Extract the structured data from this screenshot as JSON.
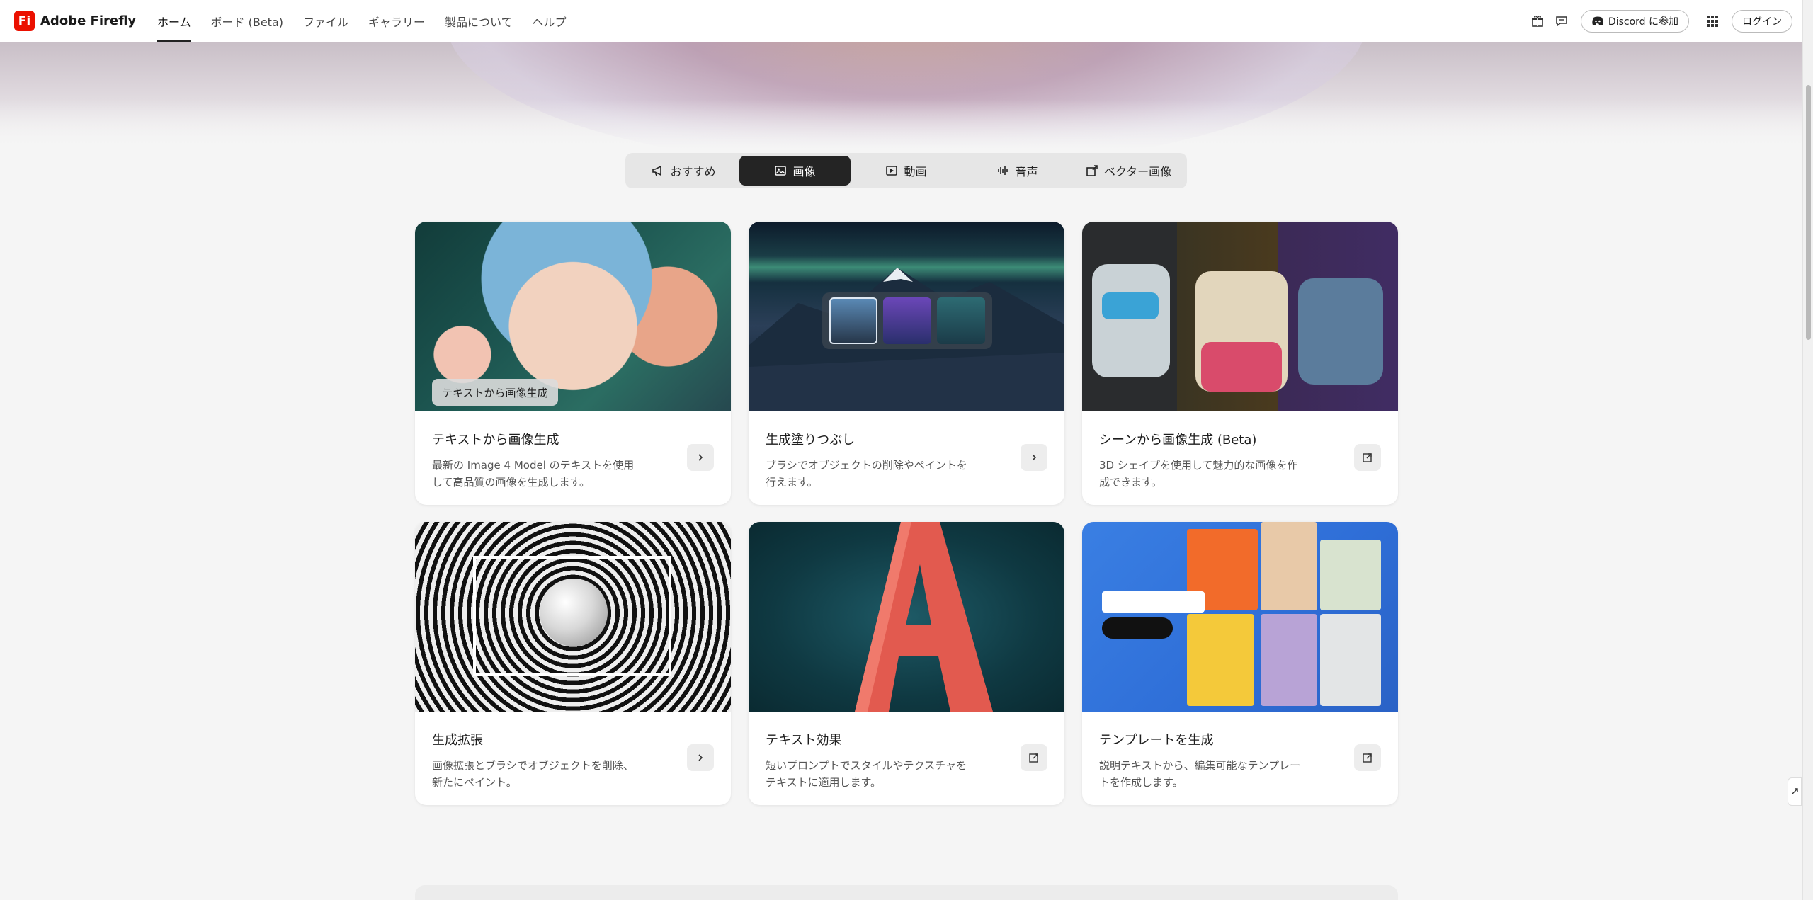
{
  "brand": {
    "logo_text": "Fi",
    "name": "Adobe Firefly"
  },
  "nav": {
    "links": [
      {
        "label": "ホーム",
        "active": true
      },
      {
        "label": "ボード (Beta)"
      },
      {
        "label": "ファイル"
      },
      {
        "label": "ギャラリー"
      },
      {
        "label": "製品について"
      },
      {
        "label": "ヘルプ"
      }
    ],
    "discord_label": "Discord に参加",
    "login_label": "ログイン",
    "icons": [
      "gift-icon",
      "chat-icon",
      "discord-icon",
      "apps-grid-icon"
    ]
  },
  "tabs": [
    {
      "label": "おすすめ",
      "icon": "megaphone-icon"
    },
    {
      "label": "画像",
      "icon": "image-icon",
      "active": true
    },
    {
      "label": "動画",
      "icon": "video-icon"
    },
    {
      "label": "音声",
      "icon": "audio-wave-icon"
    },
    {
      "label": "ベクター画像",
      "icon": "vector-icon"
    }
  ],
  "cards": [
    {
      "title": "テキストから画像生成",
      "desc": "最新の Image 4 Model のテキストを使用して高品質の画像を生成します。",
      "image_label": "テキストから画像生成",
      "action_icon": "chevron-right-icon"
    },
    {
      "title": "生成塗りつぶし",
      "desc": "ブラシでオブジェクトの削除やペイントを行えます。",
      "action_icon": "chevron-right-icon"
    },
    {
      "title": "シーンから画像生成 (Beta)",
      "desc": "3D シェイプを使用して魅力的な画像を作成できます。",
      "action_icon": "external-link-icon"
    },
    {
      "title": "生成拡張",
      "desc": "画像拡張とブラシでオブジェクトを削除、新たにペイント。",
      "action_icon": "chevron-right-icon"
    },
    {
      "title": "テキスト効果",
      "desc": "短いプロンプトでスタイルやテクスチャをテキストに適用します。",
      "action_icon": "external-link-icon"
    },
    {
      "title": "テンプレートを生成",
      "desc": "説明テキストから、編集可能なテンプレートを作成します。",
      "action_icon": "external-link-icon"
    }
  ],
  "colors": {
    "brand_red": "#eb1000",
    "active_tab": "#242424",
    "card_bg": "#ffffff",
    "page_bg": "#f5f5f5"
  }
}
